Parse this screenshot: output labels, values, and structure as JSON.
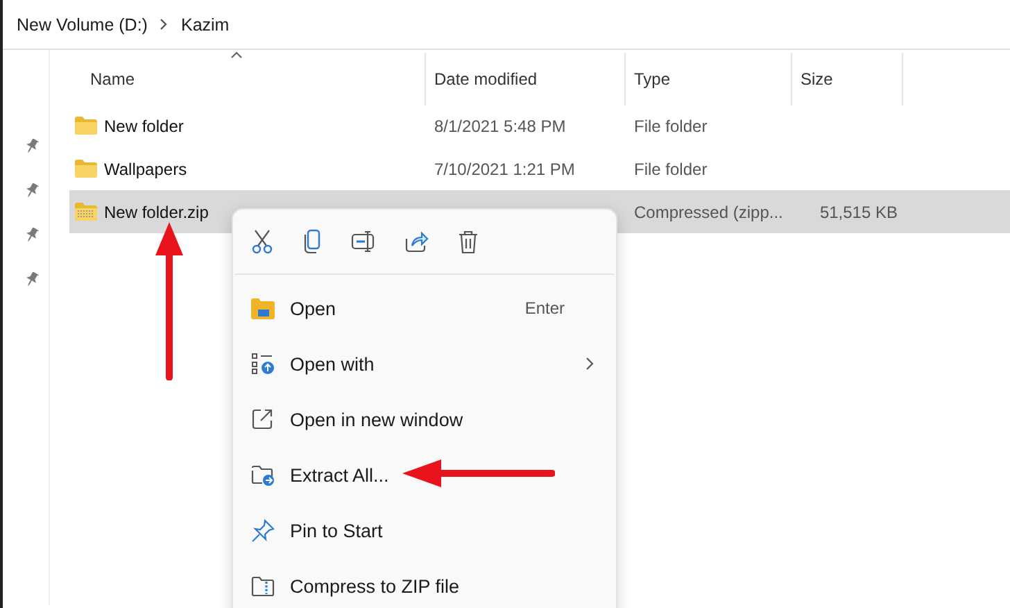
{
  "breadcrumb": [
    {
      "label": "New Volume (D:)"
    },
    {
      "label": "Kazim"
    }
  ],
  "columns": [
    {
      "label": "Name",
      "sorted": true
    },
    {
      "label": "Date modified",
      "sorted": false
    },
    {
      "label": "Type",
      "sorted": false
    },
    {
      "label": "Size",
      "sorted": false
    }
  ],
  "rows": [
    {
      "kind": "folder",
      "name": "New folder",
      "date": "8/1/2021 5:48 PM",
      "type": "File folder",
      "selected": false
    },
    {
      "kind": "folder",
      "name": "Wallpapers",
      "date": "7/10/2021 1:21 PM",
      "type": "File folder",
      "selected": false
    },
    {
      "kind": "zip",
      "name": "New folder.zip",
      "type": "Compressed (zipp...",
      "size": "51,515 KB",
      "selected": true
    }
  ],
  "context_menu": {
    "items": [
      {
        "label": "Open",
        "shortcut": "Enter",
        "submenu": false
      },
      {
        "label": "Open with",
        "submenu": true
      },
      {
        "label": "Open in new window",
        "submenu": false
      },
      {
        "label": "Extract All...",
        "submenu": false
      },
      {
        "label": "Pin to Start",
        "submenu": false
      },
      {
        "label": "Compress to ZIP file",
        "submenu": false
      }
    ]
  }
}
